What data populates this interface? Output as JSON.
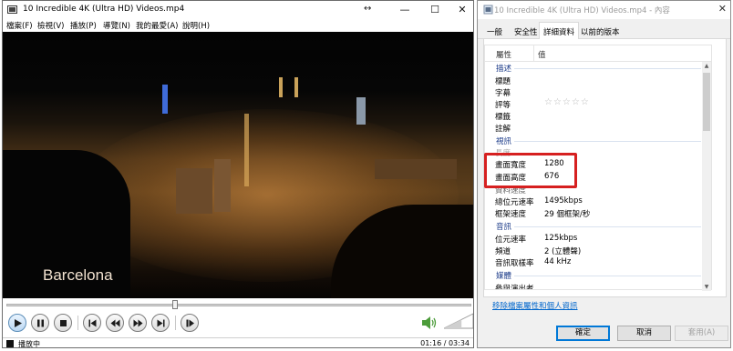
{
  "player": {
    "title": "10 Incredible 4K (Ultra HD) Videos.mp4",
    "window_controls": {
      "minimize": "—",
      "maximize": "☐",
      "close": "✕"
    },
    "menu": [
      "檔案(F)",
      "檢視(V)",
      "播放(P)",
      "導覽(N)",
      "我的最愛(A)",
      "說明(H)"
    ],
    "caption": "Barcelona",
    "status": "播放中",
    "time": "01:16 / 03:34",
    "progress": 0.355,
    "volume_level": 0.6,
    "accent_color": "#0078d7",
    "icons": {
      "play": "play-icon",
      "pause": "pause-icon",
      "stop": "stop-icon",
      "previous": "skip-back-icon",
      "rewind": "rewind-icon",
      "forward": "fast-forward-icon",
      "next": "skip-forward-icon",
      "frame_step": "frame-step-icon",
      "volume": "speaker-icon"
    }
  },
  "dialog": {
    "title": "10 Incredible 4K (Ultra HD) Videos.mp4 - 內容",
    "close": "✕",
    "tabs": [
      "一般",
      "安全性",
      "詳細資料",
      "以前的版本"
    ],
    "active_tab": "詳細資料",
    "columns": {
      "property": "屬性",
      "value": "值"
    },
    "groups": {
      "description": "描述",
      "video": "視訊",
      "audio": "音訊",
      "media": "媒體"
    },
    "rows": {
      "title": {
        "label": "標題",
        "value": ""
      },
      "subtitle": {
        "label": "字幕",
        "value": ""
      },
      "rating": {
        "label": "評等",
        "value": "☆☆☆☆☆"
      },
      "tags": {
        "label": "標籤",
        "value": ""
      },
      "comments": {
        "label": "註解",
        "value": ""
      },
      "frame_width": {
        "label": "畫面寬度",
        "value": "1280"
      },
      "frame_height": {
        "label": "畫面高度",
        "value": "676"
      },
      "data_rate": {
        "label": "資料速度",
        "value": ""
      },
      "total_bitrate": {
        "label": "總位元速率",
        "value": "1495kbps"
      },
      "frame_rate": {
        "label": "框架速度",
        "value": "29 個框架/秒"
      },
      "audio_bitrate": {
        "label": "位元速率",
        "value": "125kbps"
      },
      "channels": {
        "label": "頻道",
        "value": "2 (立體聲)"
      },
      "sample_rate": {
        "label": "音訊取樣率",
        "value": "44 kHz"
      },
      "contributing_artists": {
        "label": "參與演出者",
        "value": ""
      }
    },
    "remove_link": "移除檔案屬性和個人資訊",
    "buttons": {
      "ok": "確定",
      "cancel": "取消",
      "apply": "套用(A)"
    },
    "highlight_color": "#d62020"
  }
}
